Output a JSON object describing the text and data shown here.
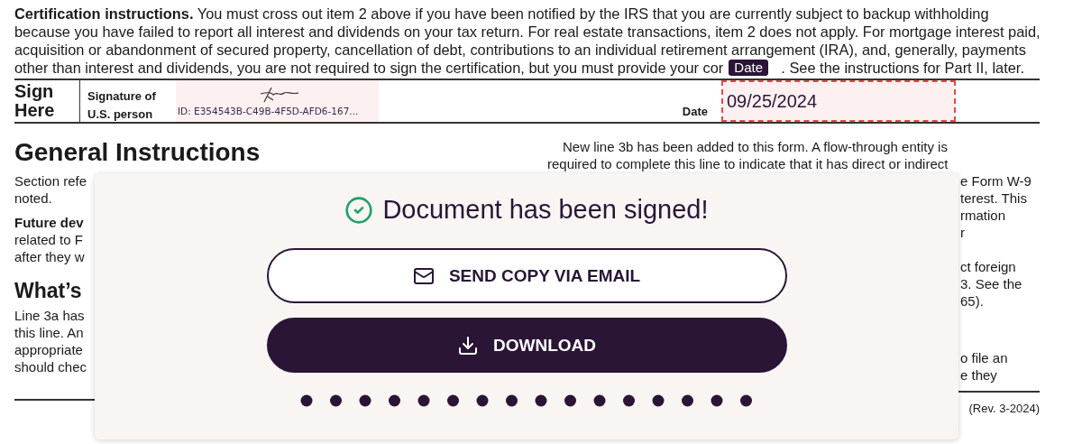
{
  "certification": {
    "lines": [
      "**Certification instructions.** You must cross out item 2 above if you have been notified by the IRS that you are currently subject to backup withholding",
      "because you have failed to report all interest and dividends on your tax return. For real estate transactions, item 2 does not apply. For mortgage interest paid,",
      "acquisition or abandonment of secured property, cancellation of debt, contributions to an individual retirement arrangement (IRA), and, generally, payments"
    ],
    "last_line_parts": [
      "other than interest and dividends, you are not required to sign the certification, but you must provide your cor",
      ". See the instructions for Part II, later."
    ]
  },
  "sign_row": {
    "sign_label": "Sign Here",
    "signature_label": "Signature of U.S. person",
    "signature_id": "ID: E354543B-C49B-4F5D-AFD6-167...",
    "date_label": "Date",
    "date_value": "09/25/2024",
    "date_tooltip": "Date"
  },
  "left_column": {
    "heading": "General Instructions",
    "paragraphs": [
      [
        "Section refe",
        "noted."
      ],
      [
        "**Future dev**",
        "related to F",
        "after they w"
      ]
    ],
    "subheading": "What’s",
    "subparagraphs": [
      [
        "Line 3a has",
        "this line. An",
        "appropriate",
        "should chec"
      ]
    ]
  },
  "right_column": {
    "lines": [
      "New line 3b has been added to this form. A flow-through entity is",
      "required to complete this line to indicate that it has direct or indirect"
    ],
    "fragments": [
      [
        "e Form W-9",
        "terest. This",
        "rmation",
        "r"
      ],
      [
        "ct foreign",
        "3. See the",
        "65)."
      ],
      [
        "o file an",
        "e they"
      ]
    ],
    "form_revision": "(Rev. 3-2024)"
  },
  "dialog": {
    "title": "Document has been signed!",
    "buttons": [
      {
        "label": "SEND COPY VIA EMAIL",
        "kind": "outline"
      },
      {
        "label": "DOWNLOAD",
        "kind": "filled"
      }
    ]
  }
}
